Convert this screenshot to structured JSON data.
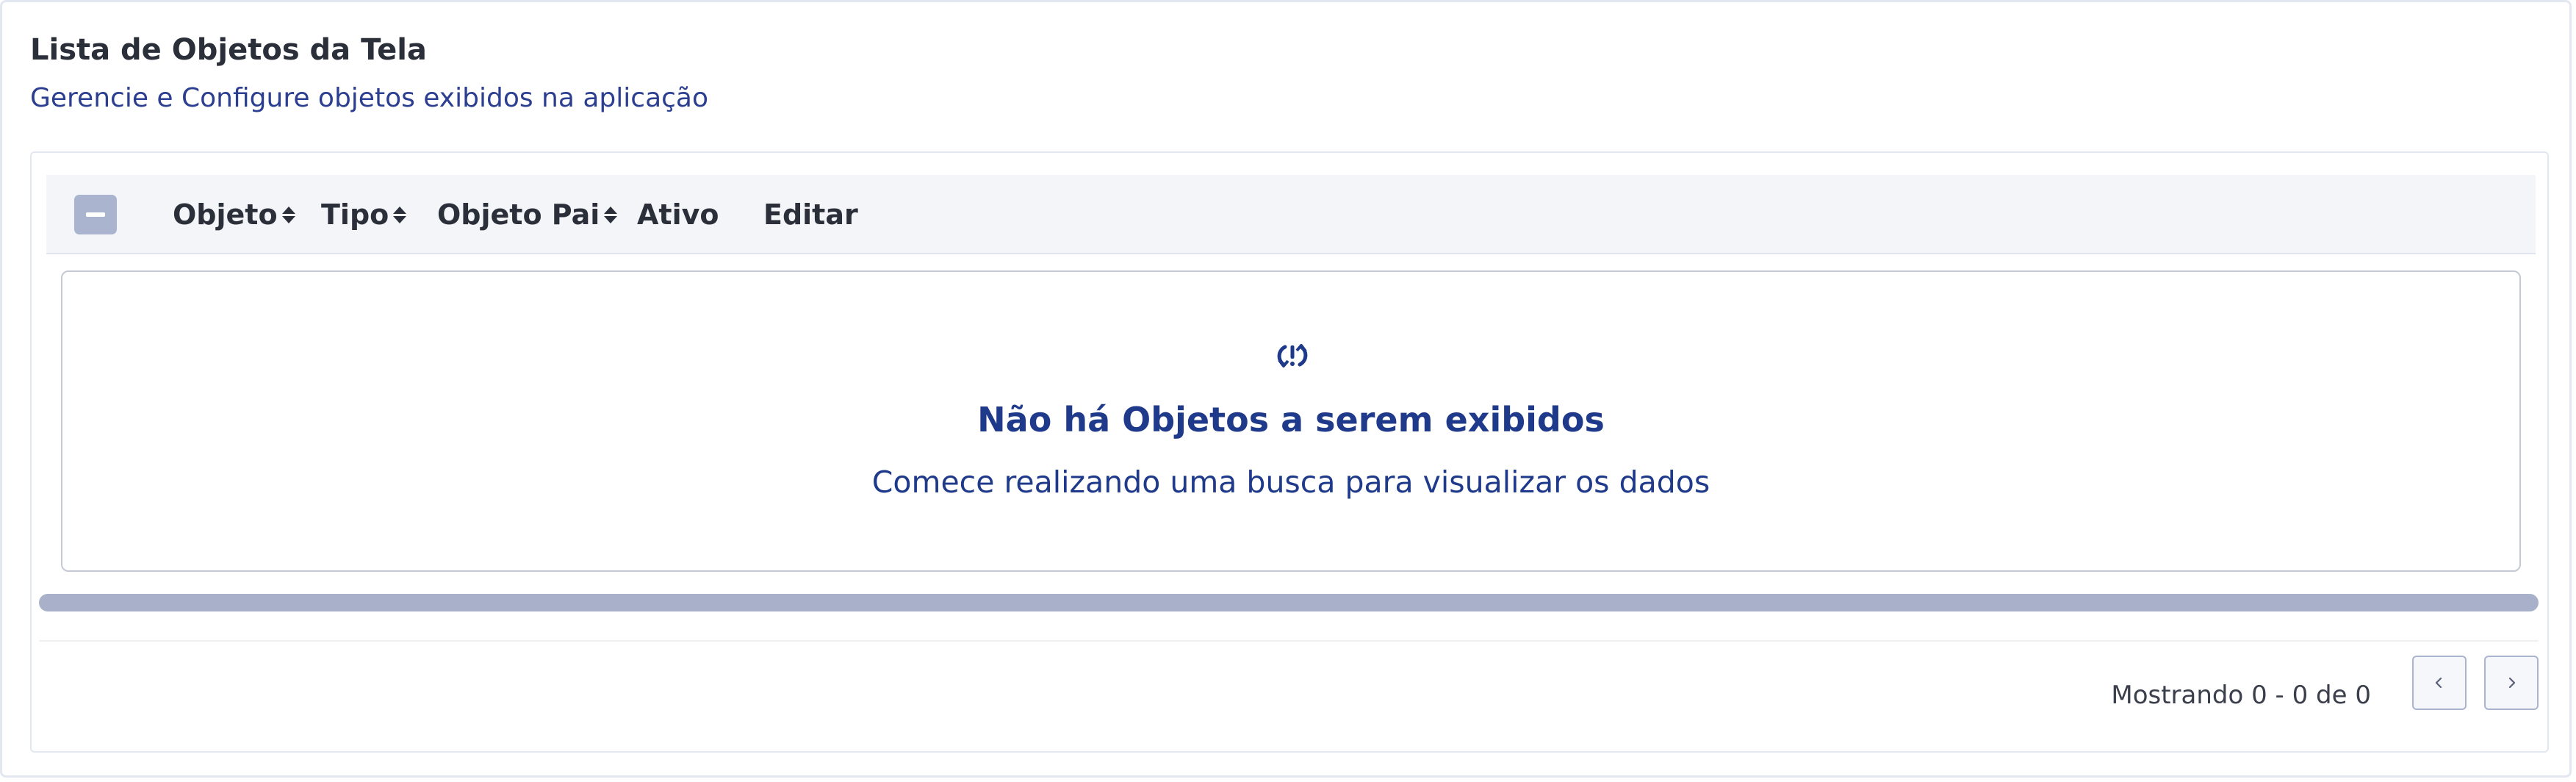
{
  "header": {
    "title": "Lista de Objetos da Tela",
    "subtitle": "Gerencie e Configure objetos exibidos na aplicação"
  },
  "table": {
    "columns": [
      {
        "label": "Objeto",
        "sortable": true
      },
      {
        "label": "Tipo",
        "sortable": true
      },
      {
        "label": "Objeto Pai",
        "sortable": true
      },
      {
        "label": "Ativo",
        "sortable": false
      },
      {
        "label": "Editar",
        "sortable": false
      }
    ]
  },
  "empty_state": {
    "icon": "refresh-alert-icon",
    "title": "Não há Objetos a serem exibidos",
    "message": "Comece realizando uma busca para visualizar os dados"
  },
  "pagination": {
    "info": "Mostrando 0 - 0 de 0",
    "prev_icon": "chevron-left-icon",
    "next_icon": "chevron-right-icon"
  },
  "colors": {
    "accent": "#1f3a8a",
    "checkbox": "#aab4cf",
    "scrollbar": "#a9b0c9"
  }
}
